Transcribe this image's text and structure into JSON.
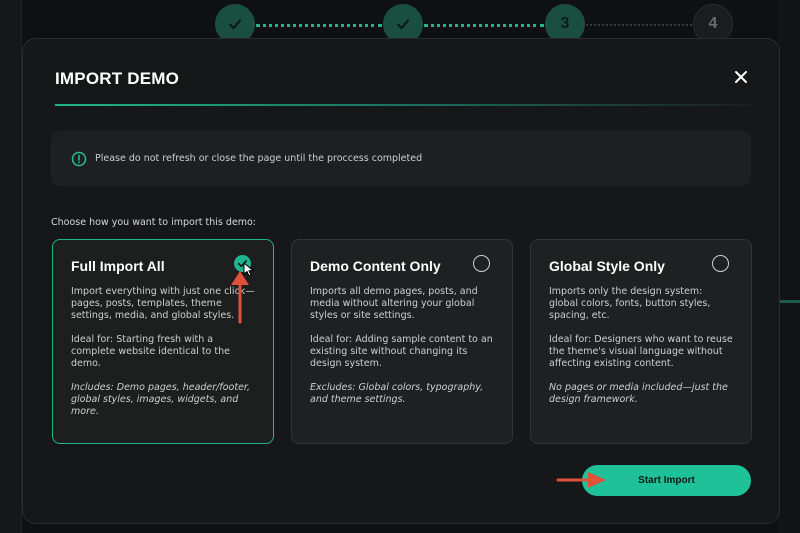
{
  "stepper": {
    "steps": [
      "",
      "",
      "3",
      "4"
    ],
    "states": [
      "done",
      "done",
      "active",
      "todo"
    ]
  },
  "modal": {
    "title": "IMPORT DEMO",
    "close_icon": "close-icon"
  },
  "notice": {
    "icon": "info-circle-icon",
    "text": "Please do not refresh or close the page until the proccess completed"
  },
  "prompt": "Choose how you want to import this demo:",
  "options": [
    {
      "title": "Full Import All",
      "selected": true,
      "description": "Import everything with just one click—pages, posts, templates, theme settings, media, and global styles.",
      "ideal": "Ideal for: Starting fresh with a complete website identical to the demo.",
      "note": "Includes: Demo pages, header/footer, global styles, images, widgets, and more."
    },
    {
      "title": "Demo Content Only",
      "selected": false,
      "description": "Imports all demo pages, posts, and media without altering your global styles or site settings.",
      "ideal": "Ideal for: Adding sample content to an existing site without changing its design system.",
      "note": "Excludes: Global colors, typography, and theme settings."
    },
    {
      "title": "Global Style Only",
      "selected": false,
      "description": "Imports only the design system: global colors, fonts, button styles, spacing, etc.",
      "ideal": "Ideal for: Designers who want to reuse the theme's visual language without affecting existing content.",
      "note": "No pages or media included—just the design framework."
    }
  ],
  "actions": {
    "start_label": "Start Import"
  },
  "colors": {
    "accent": "#1fc198",
    "background": "#0f1011",
    "modal": "#161718",
    "annotation_arrow": "#e0503a"
  }
}
